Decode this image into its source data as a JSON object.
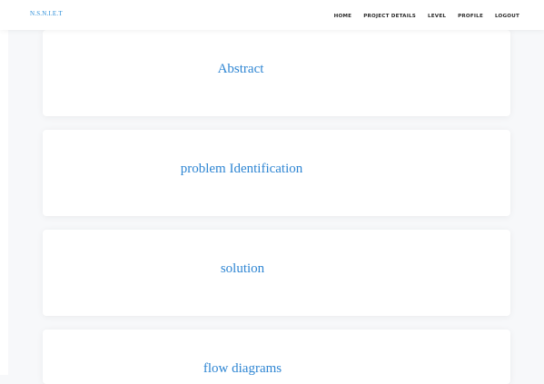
{
  "navbar": {
    "brand": "N.S.N.I.E.T",
    "links": [
      {
        "label": "HOME"
      },
      {
        "label": "PROJECT DETAILS"
      },
      {
        "label": "LEVEL"
      },
      {
        "label": "PROFILE"
      },
      {
        "label": "LOGOUT"
      }
    ]
  },
  "cards": [
    {
      "title": "Abstract"
    },
    {
      "title": "problem Identification"
    },
    {
      "title": "solution"
    },
    {
      "title": "flow diagrams"
    }
  ],
  "colors": {
    "accent": "#2f86d3",
    "page_background": "#f7f8fa",
    "card_background": "#ffffff",
    "nav_text": "#2a2a2a"
  }
}
